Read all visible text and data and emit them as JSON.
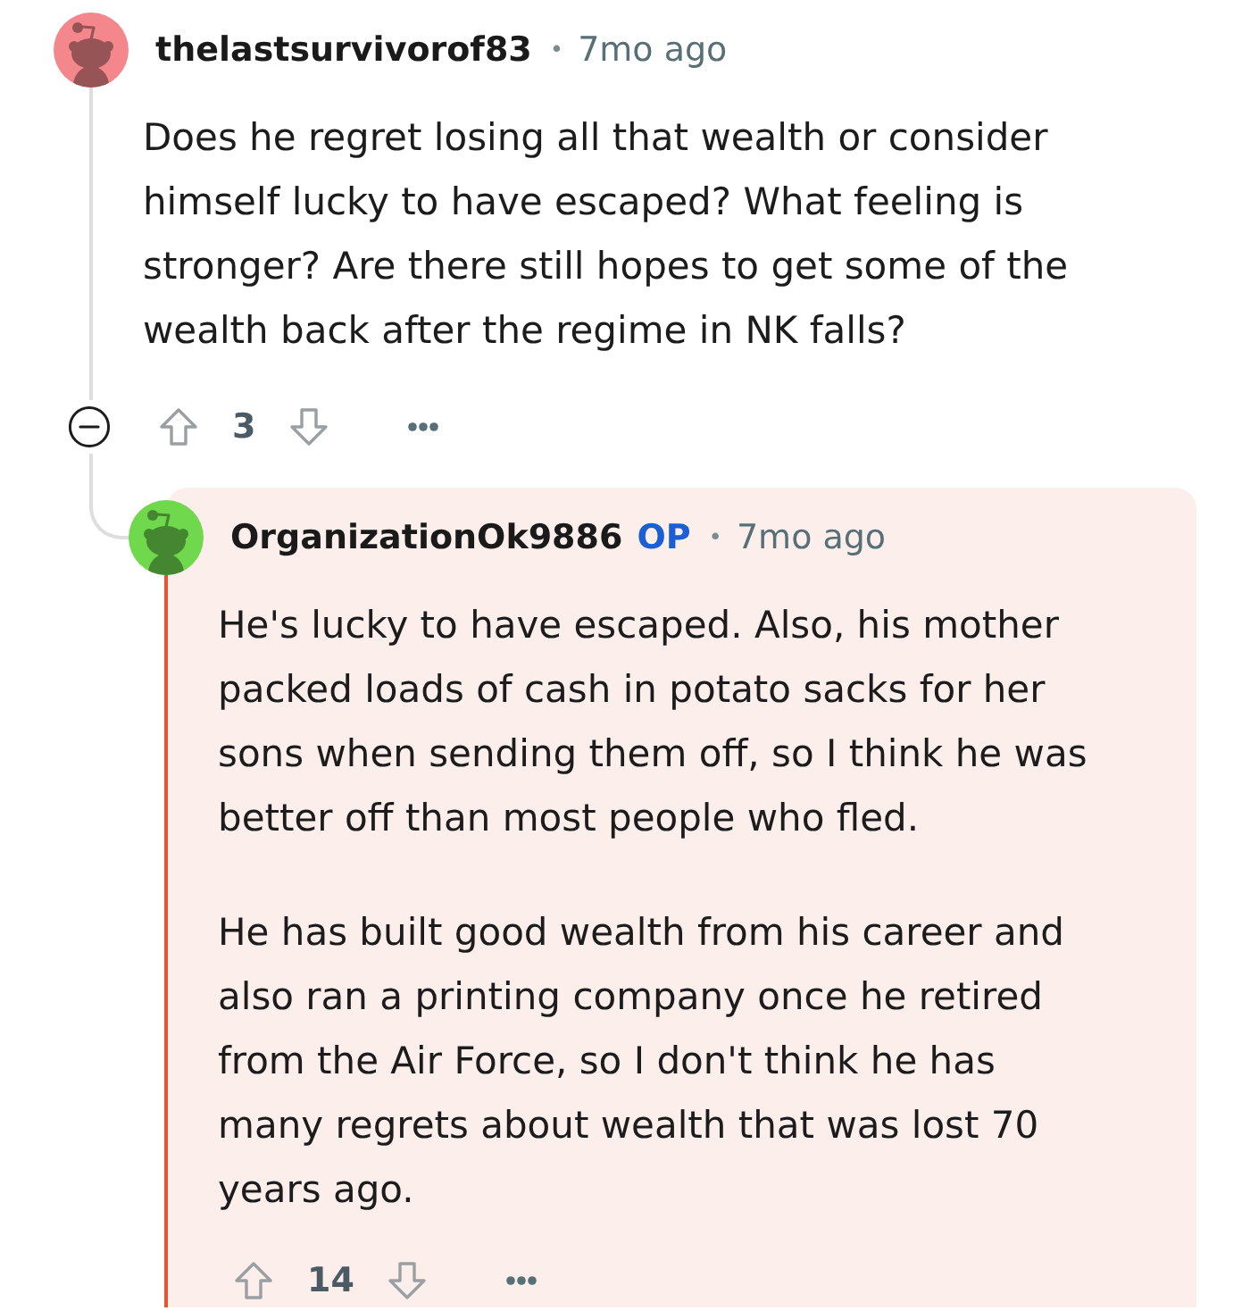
{
  "comments": [
    {
      "author": "thelastsurvivorof83",
      "separator": "•",
      "time": "7mo ago",
      "color": "#f4878c",
      "paragraphs": [
        "Does he regret losing all that wealth or consider himself lucky to have escaped? What feeling is stronger? Are there still hopes to get some of the wealth back after the regime in NK falls?"
      ],
      "expanded": true,
      "score": "3",
      "children": [
        {
          "author": "OrganizationOk9886",
          "badge": "OP",
          "separator": "•",
          "time": "7mo ago",
          "color": "#6fd84d",
          "highlighted": true,
          "paragraphs": [
            "He's lucky to have escaped. Also, his mother packed loads of cash in potato sacks for her sons when sending them off, so I think he was better off than most people who fled.",
            "He has built good wealth from his career and also ran a printing company once he retired from the Air Force, so I don't think he has many regrets about wealth that was lost 70 years ago."
          ],
          "score": "14"
        }
      ]
    }
  ]
}
